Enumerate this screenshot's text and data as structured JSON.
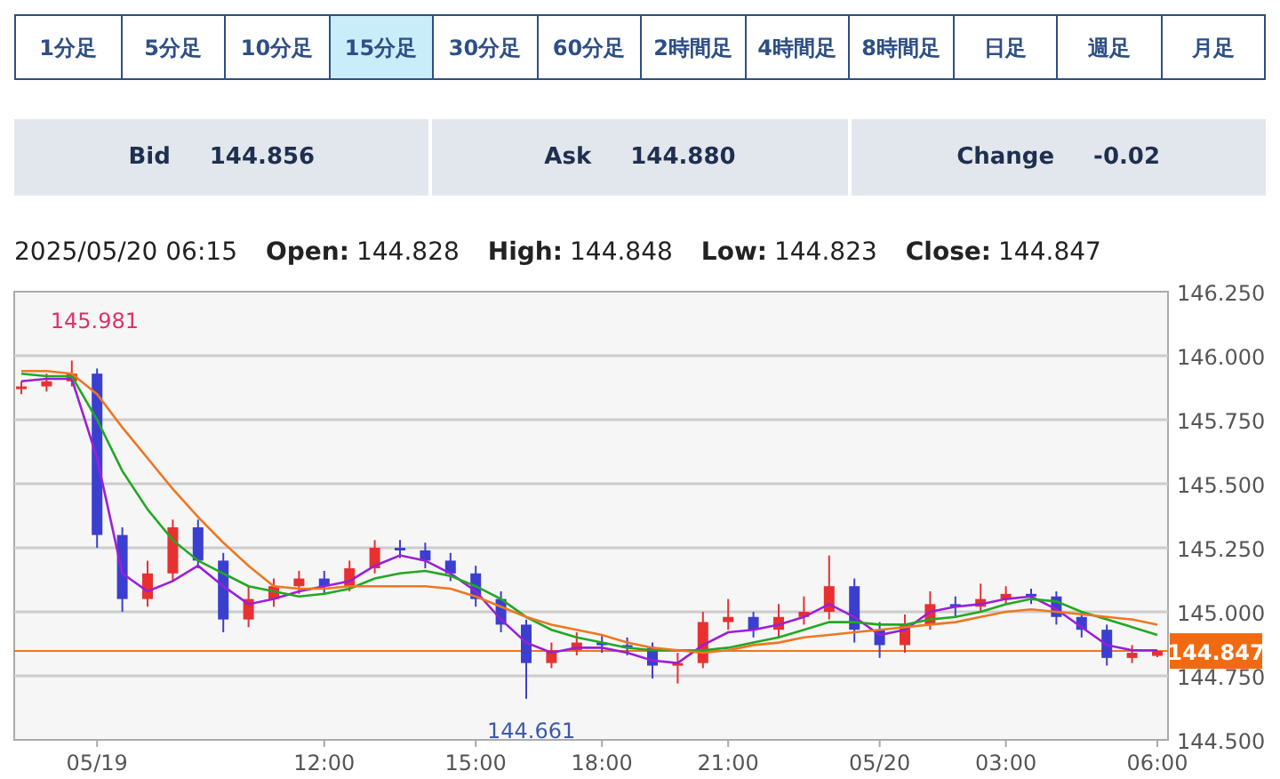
{
  "tabs": [
    {
      "label": "1分足",
      "selected": false
    },
    {
      "label": "5分足",
      "selected": false
    },
    {
      "label": "10分足",
      "selected": false
    },
    {
      "label": "15分足",
      "selected": true
    },
    {
      "label": "30分足",
      "selected": false
    },
    {
      "label": "60分足",
      "selected": false
    },
    {
      "label": "2時間足",
      "selected": false
    },
    {
      "label": "4時間足",
      "selected": false
    },
    {
      "label": "8時間足",
      "selected": false
    },
    {
      "label": "日足",
      "selected": false
    },
    {
      "label": "週足",
      "selected": false
    },
    {
      "label": "月足",
      "selected": false
    }
  ],
  "quotes": [
    {
      "label": "Bid",
      "value": "144.856"
    },
    {
      "label": "Ask",
      "value": "144.880"
    },
    {
      "label": "Change",
      "value": "-0.02"
    }
  ],
  "ohlc": {
    "time": "2025/05/20 06:15",
    "fields": [
      {
        "label": "Open:",
        "value": "144.828"
      },
      {
        "label": "High:",
        "value": "144.848"
      },
      {
        "label": "Low:",
        "value": "144.823"
      },
      {
        "label": "Close:",
        "value": "144.847"
      }
    ]
  },
  "chart": {
    "current_price": "144.847",
    "chart_data": {
      "type": "candlestick",
      "categories": [
        null,
        null,
        null,
        "05/19",
        null,
        null,
        null,
        null,
        null,
        null,
        null,
        null,
        "12:00",
        null,
        null,
        null,
        null,
        null,
        "15:00",
        null,
        null,
        null,
        null,
        "18:00",
        null,
        null,
        null,
        null,
        "21:00",
        null,
        null,
        null,
        null,
        null,
        "05/20",
        null,
        null,
        null,
        null,
        "03:00",
        null,
        null,
        null,
        null,
        null,
        "06:00"
      ],
      "ylim": [
        144.5,
        146.25
      ],
      "yticks": [
        {
          "value": 144.5,
          "label": "144.500"
        },
        {
          "value": 144.75,
          "label": "144.750"
        },
        {
          "value": 145,
          "label": "145.000"
        },
        {
          "value": 145.25,
          "label": "145.250"
        },
        {
          "value": 145.5,
          "label": "145.500"
        },
        {
          "value": 145.75,
          "label": "145.750"
        },
        {
          "value": 146,
          "label": "146.000"
        },
        {
          "value": 146.25,
          "label": "146.250"
        }
      ],
      "ohlc": [
        [
          145.87,
          145.9,
          145.85,
          145.88
        ],
        [
          145.88,
          145.93,
          145.86,
          145.9
        ],
        [
          145.9,
          145.981,
          145.88,
          145.93
        ],
        [
          145.93,
          145.95,
          145.25,
          145.3
        ],
        [
          145.3,
          145.33,
          145.0,
          145.05
        ],
        [
          145.05,
          145.2,
          145.02,
          145.15
        ],
        [
          145.15,
          145.36,
          145.12,
          145.33
        ],
        [
          145.33,
          145.36,
          145.17,
          145.2
        ],
        [
          145.2,
          145.23,
          144.92,
          144.97
        ],
        [
          144.97,
          145.1,
          144.94,
          145.05
        ],
        [
          145.05,
          145.13,
          145.02,
          145.1
        ],
        [
          145.1,
          145.16,
          145.07,
          145.13
        ],
        [
          145.13,
          145.16,
          145.07,
          145.1
        ],
        [
          145.1,
          145.2,
          145.08,
          145.17
        ],
        [
          145.17,
          145.28,
          145.15,
          145.25
        ],
        [
          145.25,
          145.28,
          145.21,
          145.24
        ],
        [
          145.24,
          145.27,
          145.17,
          145.2
        ],
        [
          145.2,
          145.23,
          145.12,
          145.15
        ],
        [
          145.15,
          145.18,
          145.02,
          145.05
        ],
        [
          145.05,
          145.08,
          144.92,
          144.95
        ],
        [
          144.95,
          144.97,
          144.661,
          144.8
        ],
        [
          144.8,
          144.88,
          144.78,
          144.85
        ],
        [
          144.85,
          144.92,
          144.83,
          144.88
        ],
        [
          144.88,
          144.91,
          144.84,
          144.87
        ],
        [
          144.87,
          144.9,
          144.83,
          144.86
        ],
        [
          144.86,
          144.88,
          144.74,
          144.79
        ],
        [
          144.79,
          144.84,
          144.72,
          144.8
        ],
        [
          144.8,
          145,
          144.78,
          144.96
        ],
        [
          144.96,
          145.05,
          144.93,
          144.98
        ],
        [
          144.98,
          145.0,
          144.9,
          144.93
        ],
        [
          144.93,
          145.03,
          144.9,
          144.98
        ],
        [
          144.98,
          145.06,
          144.95,
          145
        ],
        [
          145,
          145.22,
          144.97,
          145.1
        ],
        [
          145.1,
          145.13,
          144.88,
          144.93
        ],
        [
          144.93,
          144.96,
          144.82,
          144.87
        ],
        [
          144.87,
          144.99,
          144.84,
          144.95
        ],
        [
          144.95,
          145.08,
          144.93,
          145.03
        ],
        [
          145.03,
          145.06,
          144.98,
          145.02
        ],
        [
          145.02,
          145.11,
          145.0,
          145.05
        ],
        [
          145.05,
          145.1,
          145.03,
          145.07
        ],
        [
          145.07,
          145.09,
          145.03,
          145.06
        ],
        [
          145.06,
          145.08,
          144.95,
          144.98
        ],
        [
          144.98,
          145.0,
          144.9,
          144.93
        ],
        [
          144.93,
          144.95,
          144.79,
          144.82
        ],
        [
          144.82,
          144.87,
          144.8,
          144.84
        ],
        [
          144.828,
          144.848,
          144.823,
          144.847
        ]
      ],
      "series": [
        {
          "type": "line",
          "color": "#9b1fd8",
          "values": [
            145.9,
            145.91,
            145.91,
            145.6,
            145.15,
            145.08,
            145.12,
            145.18,
            145.1,
            145.03,
            145.05,
            145.08,
            145.1,
            145.12,
            145.18,
            145.22,
            145.2,
            145.15,
            145.08,
            144.97,
            144.88,
            144.84,
            144.86,
            144.86,
            144.84,
            144.81,
            144.8,
            144.87,
            144.92,
            144.93,
            144.95,
            144.98,
            145.03,
            144.98,
            144.91,
            144.93,
            145,
            145.02,
            145.03,
            145.05,
            145.06,
            145.01,
            144.94,
            144.87,
            144.85,
            144.85
          ]
        },
        {
          "type": "line",
          "color": "#22a822",
          "values": [
            145.93,
            145.92,
            145.92,
            145.75,
            145.55,
            145.4,
            145.28,
            145.2,
            145.15,
            145.1,
            145.08,
            145.06,
            145.07,
            145.09,
            145.13,
            145.15,
            145.16,
            145.14,
            145.1,
            145.05,
            144.98,
            144.93,
            144.9,
            144.88,
            144.86,
            144.85,
            144.85,
            144.85,
            144.86,
            144.88,
            144.9,
            144.93,
            144.96,
            144.96,
            144.95,
            144.95,
            144.97,
            144.98,
            145,
            145.03,
            145.05,
            145.04,
            145,
            144.97,
            144.94,
            144.91
          ]
        },
        {
          "type": "line",
          "color": "#ee7722",
          "values": [
            145.94,
            145.94,
            145.93,
            145.85,
            145.72,
            145.6,
            145.48,
            145.37,
            145.27,
            145.18,
            145.1,
            145.09,
            145.09,
            145.1,
            145.1,
            145.1,
            145.1,
            145.09,
            145.06,
            145.02,
            144.98,
            144.95,
            144.93,
            144.91,
            144.88,
            144.86,
            144.85,
            144.84,
            144.85,
            144.87,
            144.88,
            144.9,
            144.91,
            144.92,
            144.93,
            144.94,
            144.95,
            144.96,
            144.98,
            145,
            145.01,
            145,
            144.99,
            144.98,
            144.97,
            144.95
          ]
        }
      ],
      "grid": true,
      "ref_lines": [
        {
          "axis": "y",
          "value": 144.847,
          "color": "#ee7722"
        }
      ],
      "annotations": [
        "145.981",
        "144.661"
      ]
    }
  }
}
